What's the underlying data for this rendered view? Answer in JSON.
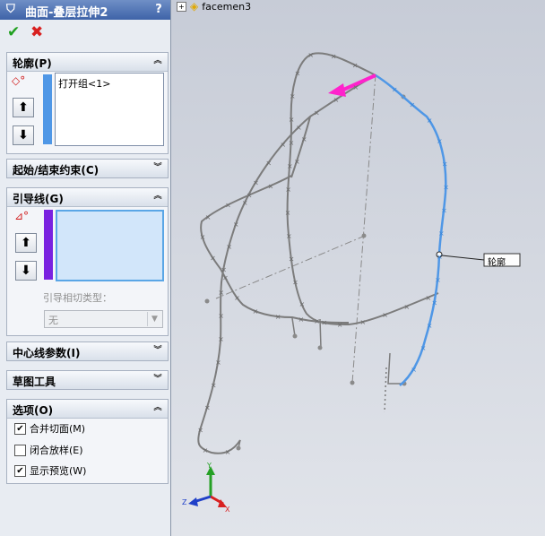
{
  "panel": {
    "title": "曲面-叠层拉伸2",
    "help": "?",
    "ok": "✔",
    "cancel": "✖"
  },
  "profile_group": {
    "header": "轮廓(P)",
    "items": [
      "打开组<1>"
    ],
    "color": "#4f97e6"
  },
  "start_end_group": {
    "header": "起始/结束约束(C)"
  },
  "guide_group": {
    "header": "引导线(G)",
    "items": [],
    "tangency_label": "引导相切类型：",
    "tangency_value": "无",
    "color": "#7a22e0"
  },
  "centerline_group": {
    "header": "中心线参数(I)"
  },
  "sketch_tools_group": {
    "header": "草图工具"
  },
  "options_group": {
    "header": "选项(O)",
    "options": [
      {
        "label": "合并切面(M)",
        "checked": true
      },
      {
        "label": "闭合放样(E)",
        "checked": false
      },
      {
        "label": "显示预览(W)",
        "checked": true
      }
    ]
  },
  "tree": {
    "item": "facemen3"
  },
  "callout": {
    "label": "轮廓"
  },
  "triad": {
    "x": "X",
    "y": "Y",
    "z": "Z"
  },
  "colors": {
    "profile_curve": "#4f97e6",
    "arrow": "#ff22cc",
    "sketch": "#7c7c7c"
  }
}
